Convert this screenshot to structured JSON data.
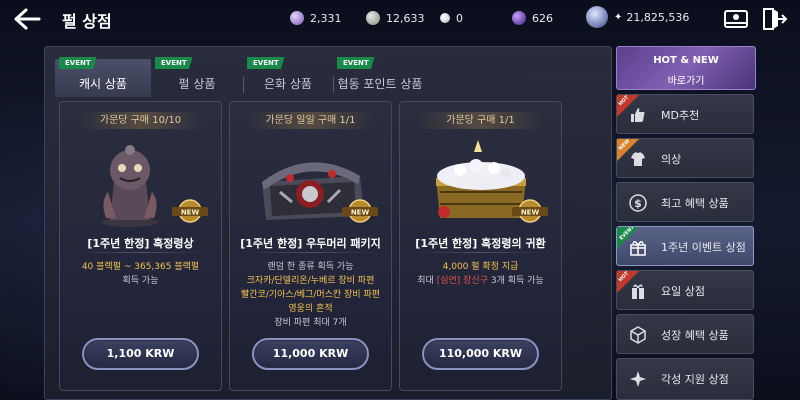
{
  "header": {
    "title": "펄 상점",
    "back_icon": "arrow-left-icon",
    "currencies": [
      {
        "icon": "purple-gem-icon",
        "value": "2,331"
      },
      {
        "icon": "silver-coin-icon",
        "value": "12,633"
      },
      {
        "icon": "pearl-icon",
        "value": "0"
      },
      {
        "icon": "dark-purple-gem-icon",
        "value": "626"
      },
      {
        "icon": "pearl-coin-icon",
        "value": "21,825,536"
      }
    ],
    "mail_icon": "mailbox-icon",
    "exit_icon": "exit-door-icon"
  },
  "tabs": [
    {
      "label": "캐시 상품",
      "badge": "EVENT",
      "active": true
    },
    {
      "label": "펄 상품",
      "badge": "EVENT",
      "active": false
    },
    {
      "label": "은화 상품",
      "badge": "EVENT",
      "active": false
    },
    {
      "label": "협동 포인트 상품",
      "badge": "EVENT",
      "active": false
    }
  ],
  "cards": [
    {
      "limit": "가문당 구매 10/10",
      "badge": "NEW",
      "title": "[1주년 한정] 흑정령상",
      "desc1": "40 블랙펄 ~ 365,365 블랙펄",
      "desc2": "획득 가능",
      "price": "1,100 KRW"
    },
    {
      "limit": "가문당 일일 구매 1/1",
      "badge": "NEW",
      "title": "[1주년 한정] 우두머리 패키지",
      "desc1": "랜덤 한 종류 획득 가능",
      "desc2": "크자카/단델리온/누베르 장비 파편",
      "desc3": "빨간코/기아스/베그/머스칸 장비 파편",
      "desc4": "영웅의 흔적",
      "desc5": "장비 파편 최대 7개",
      "price": "11,000 KRW"
    },
    {
      "limit": "가문당 구매 1/1",
      "badge": "NEW",
      "title": "[1주년 한정] 흑정령의 귀환",
      "desc1": "4,000 펄 확정 지급",
      "desc2_pre": "최대 ",
      "desc2_red": "[심연] 장신구",
      "desc2_post": " 3개 획득 가능",
      "price": "110,000 KRW"
    }
  ],
  "sidebar": {
    "hot_new_title": "HOT & NEW",
    "hot_new_sub": "바로가기",
    "items": [
      {
        "label": "MD추천",
        "icon": "thumbs-up-icon",
        "tag": "HOT",
        "tag_color": "#c0392b",
        "active": false
      },
      {
        "label": "의상",
        "icon": "costume-icon",
        "tag": "NEW",
        "tag_color": "#d9822b",
        "active": false
      },
      {
        "label": "최고 혜택 상품",
        "icon": "dollar-icon",
        "tag": "",
        "tag_color": "",
        "active": false
      },
      {
        "label": "1주년 이벤트 상점",
        "icon": "gift-icon",
        "tag": "EVENT",
        "tag_color": "#1a8a4a",
        "active": true
      },
      {
        "label": "요일 상점",
        "icon": "gift-box-icon",
        "tag": "HOT",
        "tag_color": "#c0392b",
        "active": false
      },
      {
        "label": "성장 혜택 상품",
        "icon": "box-icon",
        "tag": "",
        "tag_color": "",
        "active": false
      },
      {
        "label": "각성 지원 상점",
        "icon": "star-burst-icon",
        "tag": "",
        "tag_color": "",
        "active": false
      }
    ]
  }
}
